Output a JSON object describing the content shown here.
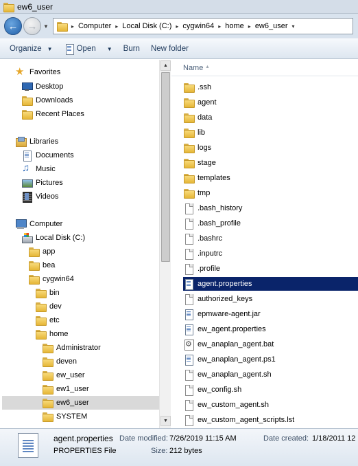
{
  "window": {
    "title": "ew6_user"
  },
  "address": {
    "breadcrumbs": [
      "Computer",
      "Local Disk (C:)",
      "cygwin64",
      "home",
      "ew6_user"
    ]
  },
  "toolbar": {
    "organize": "Organize",
    "open": "Open",
    "burn": "Burn",
    "new_folder": "New folder"
  },
  "nav": {
    "favorites": {
      "label": "Favorites",
      "items": [
        "Desktop",
        "Downloads",
        "Recent Places"
      ]
    },
    "libraries": {
      "label": "Libraries",
      "items": [
        "Documents",
        "Music",
        "Pictures",
        "Videos"
      ]
    },
    "computer": {
      "label": "Computer"
    },
    "local_disk": "Local Disk (C:)",
    "tree": {
      "app": "app",
      "bea": "bea",
      "cygwin64": "cygwin64",
      "bin": "bin",
      "dev": "dev",
      "etc": "etc",
      "home": "home",
      "home_children": [
        "Administrator",
        "deven",
        "ew_user",
        "ew1_user",
        "ew6_user",
        "SYSTEM"
      ]
    },
    "selected": "ew6_user"
  },
  "filelist": {
    "column_name": "Name",
    "items": [
      {
        "name": ".ssh",
        "icon": "folder-icon"
      },
      {
        "name": "agent",
        "icon": "folder-icon"
      },
      {
        "name": "data",
        "icon": "folder-icon"
      },
      {
        "name": "lib",
        "icon": "folder-icon"
      },
      {
        "name": "logs",
        "icon": "folder-icon"
      },
      {
        "name": "stage",
        "icon": "folder-icon"
      },
      {
        "name": "templates",
        "icon": "folder-icon"
      },
      {
        "name": "tmp",
        "icon": "folder-icon"
      },
      {
        "name": ".bash_history",
        "icon": "file-icon"
      },
      {
        "name": ".bash_profile",
        "icon": "file-icon"
      },
      {
        "name": ".bashrc",
        "icon": "file-icon"
      },
      {
        "name": ".inputrc",
        "icon": "file-icon"
      },
      {
        "name": ".profile",
        "icon": "file-icon"
      },
      {
        "name": "agent.properties",
        "icon": "document-icon"
      },
      {
        "name": "authorized_keys",
        "icon": "file-icon"
      },
      {
        "name": "epmware-agent.jar",
        "icon": "document-icon"
      },
      {
        "name": "ew_agent.properties",
        "icon": "document-icon"
      },
      {
        "name": "ew_anaplan_agent.bat",
        "icon": "batch-file-icon"
      },
      {
        "name": "ew_anaplan_agent.ps1",
        "icon": "document-icon"
      },
      {
        "name": "ew_anaplan_agent.sh",
        "icon": "file-icon"
      },
      {
        "name": "ew_config.sh",
        "icon": "file-icon"
      },
      {
        "name": "ew_custom_agent.sh",
        "icon": "file-icon"
      },
      {
        "name": "ew_custom_agent_scripts.lst",
        "icon": "file-icon"
      }
    ],
    "selected": "agent.properties"
  },
  "details": {
    "name": "agent.properties",
    "type": "PROPERTIES File",
    "modified_label": "Date modified:",
    "modified_value": "7/26/2019 11:15 AM",
    "size_label": "Size:",
    "size_value": "212 bytes",
    "created_label": "Date created:",
    "created_value": "1/18/2011 12"
  },
  "colors": {
    "selection_file": "#0a246a",
    "selection_nav": "#d9d9d9",
    "toolbar_text": "#1e395b"
  }
}
